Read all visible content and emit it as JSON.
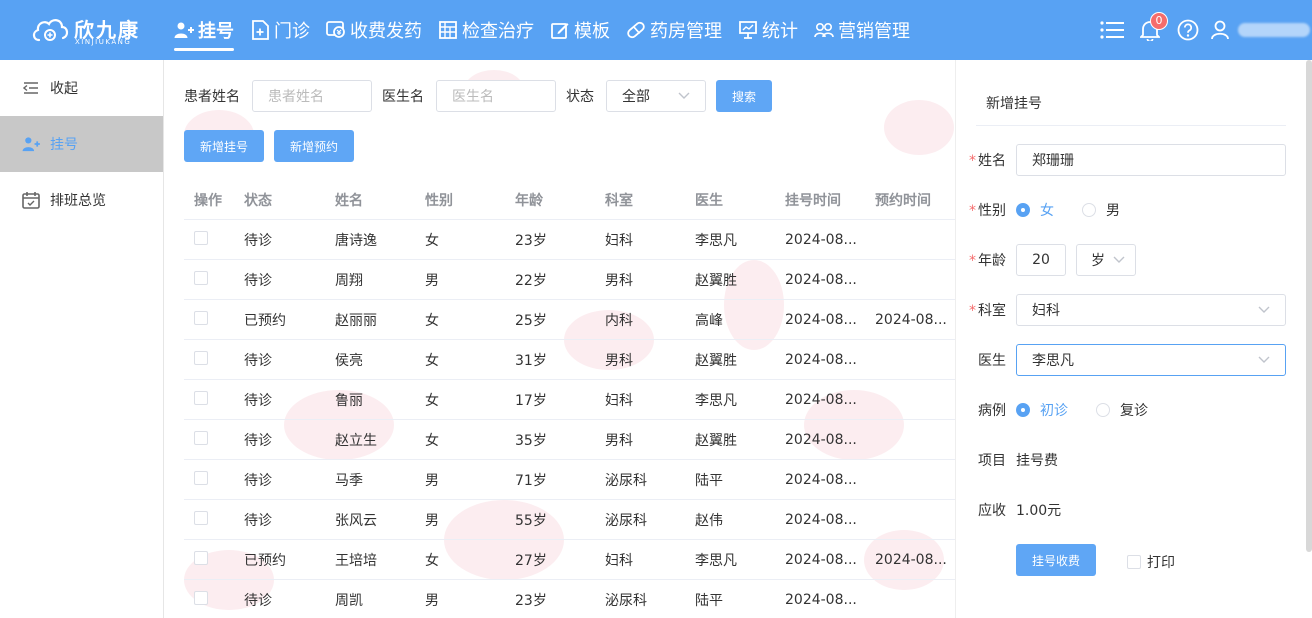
{
  "header": {
    "logo_cn": "欣九康",
    "logo_en": "XINJIUKANG",
    "nav": [
      {
        "label": "挂号",
        "icon": "add-user-icon",
        "active": true
      },
      {
        "label": "门诊",
        "icon": "clinic-plus-icon"
      },
      {
        "label": "收费发药",
        "icon": "fee-icon"
      },
      {
        "label": "检查治疗",
        "icon": "exam-grid-icon"
      },
      {
        "label": "模板",
        "icon": "edit-icon"
      },
      {
        "label": "药房管理",
        "icon": "pill-icon"
      },
      {
        "label": "统计",
        "icon": "chart-board-icon"
      },
      {
        "label": "营销管理",
        "icon": "group-icon"
      }
    ],
    "notification_count": "0"
  },
  "sidebar": {
    "items": [
      {
        "label": "收起",
        "icon": "collapse-icon"
      },
      {
        "label": "挂号",
        "icon": "add-user-icon",
        "active": true
      },
      {
        "label": "排班总览",
        "icon": "calendar-icon"
      }
    ]
  },
  "filter": {
    "patient_label": "患者姓名",
    "patient_placeholder": "患者姓名",
    "doctor_label": "医生名",
    "doctor_placeholder": "医生名",
    "status_label": "状态",
    "status_value": "全部",
    "search_label": "搜索"
  },
  "actions": {
    "new_registration": "新增挂号",
    "new_appointment": "新增预约"
  },
  "table": {
    "headers": [
      "操作",
      "状态",
      "姓名",
      "性别",
      "年龄",
      "科室",
      "医生",
      "挂号时间",
      "预约时间"
    ],
    "rows": [
      [
        "",
        "待诊",
        "唐诗逸",
        "女",
        "23岁",
        "妇科",
        "李思凡",
        "2024-08...",
        ""
      ],
      [
        "",
        "待诊",
        "周翔",
        "男",
        "22岁",
        "男科",
        "赵翼胜",
        "2024-08...",
        ""
      ],
      [
        "",
        "已预约",
        "赵丽丽",
        "女",
        "25岁",
        "内科",
        "高峰",
        "2024-08...",
        "2024-08..."
      ],
      [
        "",
        "待诊",
        "侯亮",
        "女",
        "31岁",
        "男科",
        "赵翼胜",
        "2024-08...",
        ""
      ],
      [
        "",
        "待诊",
        "鲁丽",
        "女",
        "17岁",
        "妇科",
        "李思凡",
        "2024-08...",
        ""
      ],
      [
        "",
        "待诊",
        "赵立生",
        "女",
        "35岁",
        "男科",
        "赵翼胜",
        "2024-08...",
        ""
      ],
      [
        "",
        "待诊",
        "马季",
        "男",
        "71岁",
        "泌尿科",
        "陆平",
        "2024-08...",
        ""
      ],
      [
        "",
        "待诊",
        "张风云",
        "男",
        "55岁",
        "泌尿科",
        "赵伟",
        "2024-08...",
        ""
      ],
      [
        "",
        "已预约",
        "王培培",
        "女",
        "27岁",
        "妇科",
        "李思凡",
        "2024-08...",
        "2024-08..."
      ],
      [
        "",
        "待诊",
        "周凯",
        "男",
        "23岁",
        "泌尿科",
        "陆平",
        "2024-08...",
        ""
      ]
    ]
  },
  "form": {
    "title": "新增挂号",
    "name_label": "姓名",
    "name_value": "郑珊珊",
    "gender_label": "性别",
    "gender_female": "女",
    "gender_male": "男",
    "age_label": "年龄",
    "age_value": "20",
    "age_unit": "岁",
    "dept_label": "科室",
    "dept_value": "妇科",
    "doctor_label": "医生",
    "doctor_value": "李思凡",
    "case_label": "病例",
    "case_first": "初诊",
    "case_return": "复诊",
    "item_label": "项目",
    "item_value": "挂号费",
    "due_label": "应收",
    "due_value": "1.00元",
    "submit_label": "挂号收费",
    "print_label": "打印"
  }
}
